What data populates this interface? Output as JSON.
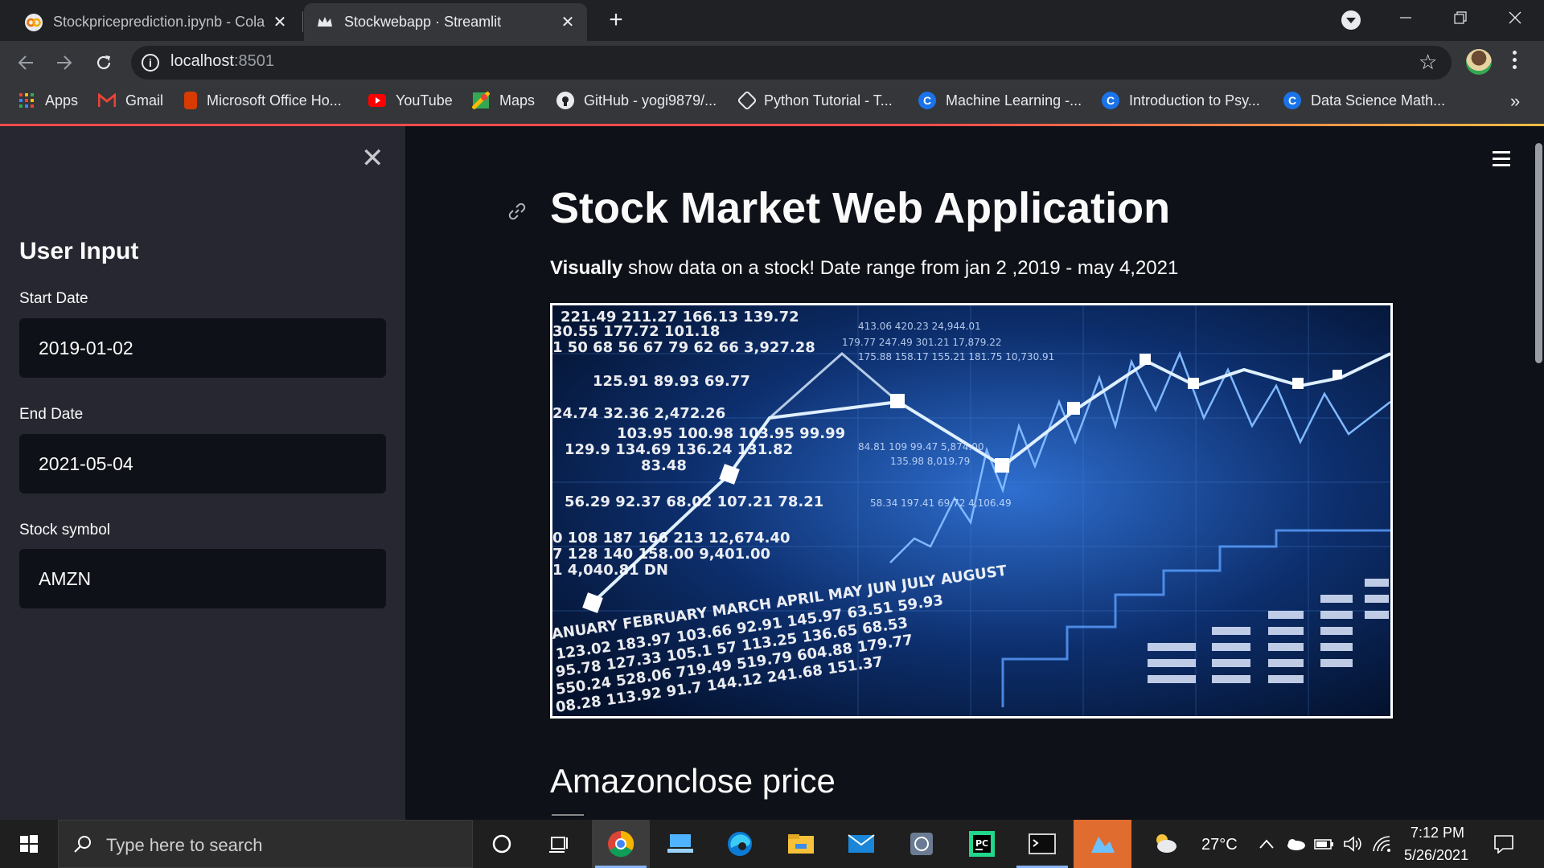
{
  "browser": {
    "tabs": [
      {
        "title": "Stockpriceprediction.ipynb - Cola",
        "favicon": "colab-icon",
        "active": false
      },
      {
        "title": "Stockwebapp · Streamlit",
        "favicon": "streamlit-crown-icon",
        "active": true
      }
    ],
    "url_host": "localhost",
    "url_port": ":8501",
    "bookmarks": [
      {
        "label": "Apps",
        "icon": "apps-grid-icon"
      },
      {
        "label": "Gmail",
        "icon": "gmail-icon"
      },
      {
        "label": "Microsoft Office Ho...",
        "icon": "office-icon"
      },
      {
        "label": "YouTube",
        "icon": "youtube-icon"
      },
      {
        "label": "Maps",
        "icon": "maps-icon"
      },
      {
        "label": "GitHub - yogi9879/...",
        "icon": "github-icon"
      },
      {
        "label": "Python Tutorial - T...",
        "icon": "python-tutorial-icon"
      },
      {
        "label": "Machine Learning -...",
        "icon": "coursera-icon"
      },
      {
        "label": "Introduction to Psy...",
        "icon": "coursera-icon"
      },
      {
        "label": "Data Science Math...",
        "icon": "coursera-icon"
      }
    ],
    "accent_color": "#ff4b4b"
  },
  "sidebar": {
    "title": "User Input",
    "start_label": "Start Date",
    "start_value": "2019-01-02",
    "end_label": "End Date",
    "end_value": "2021-05-04",
    "symbol_label": "Stock symbol",
    "symbol_value": "AMZN"
  },
  "main": {
    "title": "Stock Market Web Application",
    "subtitle_bold": "Visually",
    "subtitle_rest": " show data on a stock! Date range from jan 2 ,2019 - may 4,2021",
    "section_heading": "Amazonclose price"
  },
  "taskbar": {
    "search_placeholder": "Type here to search",
    "weather": "27°C",
    "time": "7:12 PM",
    "date": "5/26/2021"
  }
}
